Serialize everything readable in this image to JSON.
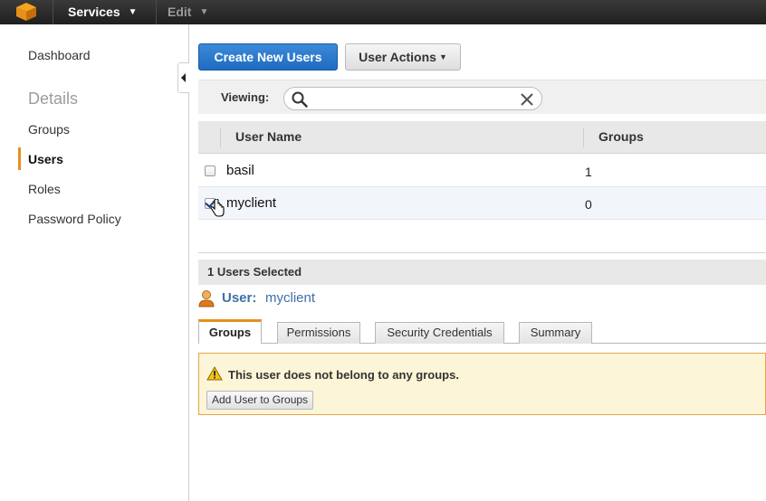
{
  "topbar": {
    "logo_icon": "aws-cube-icon",
    "services_label": "Services",
    "edit_label": "Edit"
  },
  "sidebar": {
    "dashboard": "Dashboard",
    "details_heading": "Details",
    "items": [
      {
        "label": "Groups",
        "active": false
      },
      {
        "label": "Users",
        "active": true
      },
      {
        "label": "Roles",
        "active": false
      },
      {
        "label": "Password Policy",
        "active": false
      }
    ]
  },
  "toolbar": {
    "create_label": "Create New Users",
    "actions_label": "User Actions"
  },
  "filter": {
    "viewing_label": "Viewing:",
    "search_value": ""
  },
  "table": {
    "columns": [
      "User Name",
      "Groups"
    ],
    "rows": [
      {
        "name": "basil",
        "groups": "1",
        "checked": false
      },
      {
        "name": "myclient",
        "groups": "0",
        "checked": true
      }
    ]
  },
  "selection": {
    "count_text": "1 Users Selected",
    "user_label": "User:",
    "user_name": "myclient"
  },
  "tabs": [
    "Groups",
    "Permissions",
    "Security Credentials",
    "Summary"
  ],
  "active_tab": "Groups",
  "warning": {
    "message": "This user does not belong to any groups.",
    "button_label": "Add User to Groups"
  },
  "colors": {
    "accent_orange": "#e8901c",
    "primary_blue": "#1f6bc0",
    "link_blue": "#3f6fa8",
    "warning_bg": "#fdf5d8"
  }
}
